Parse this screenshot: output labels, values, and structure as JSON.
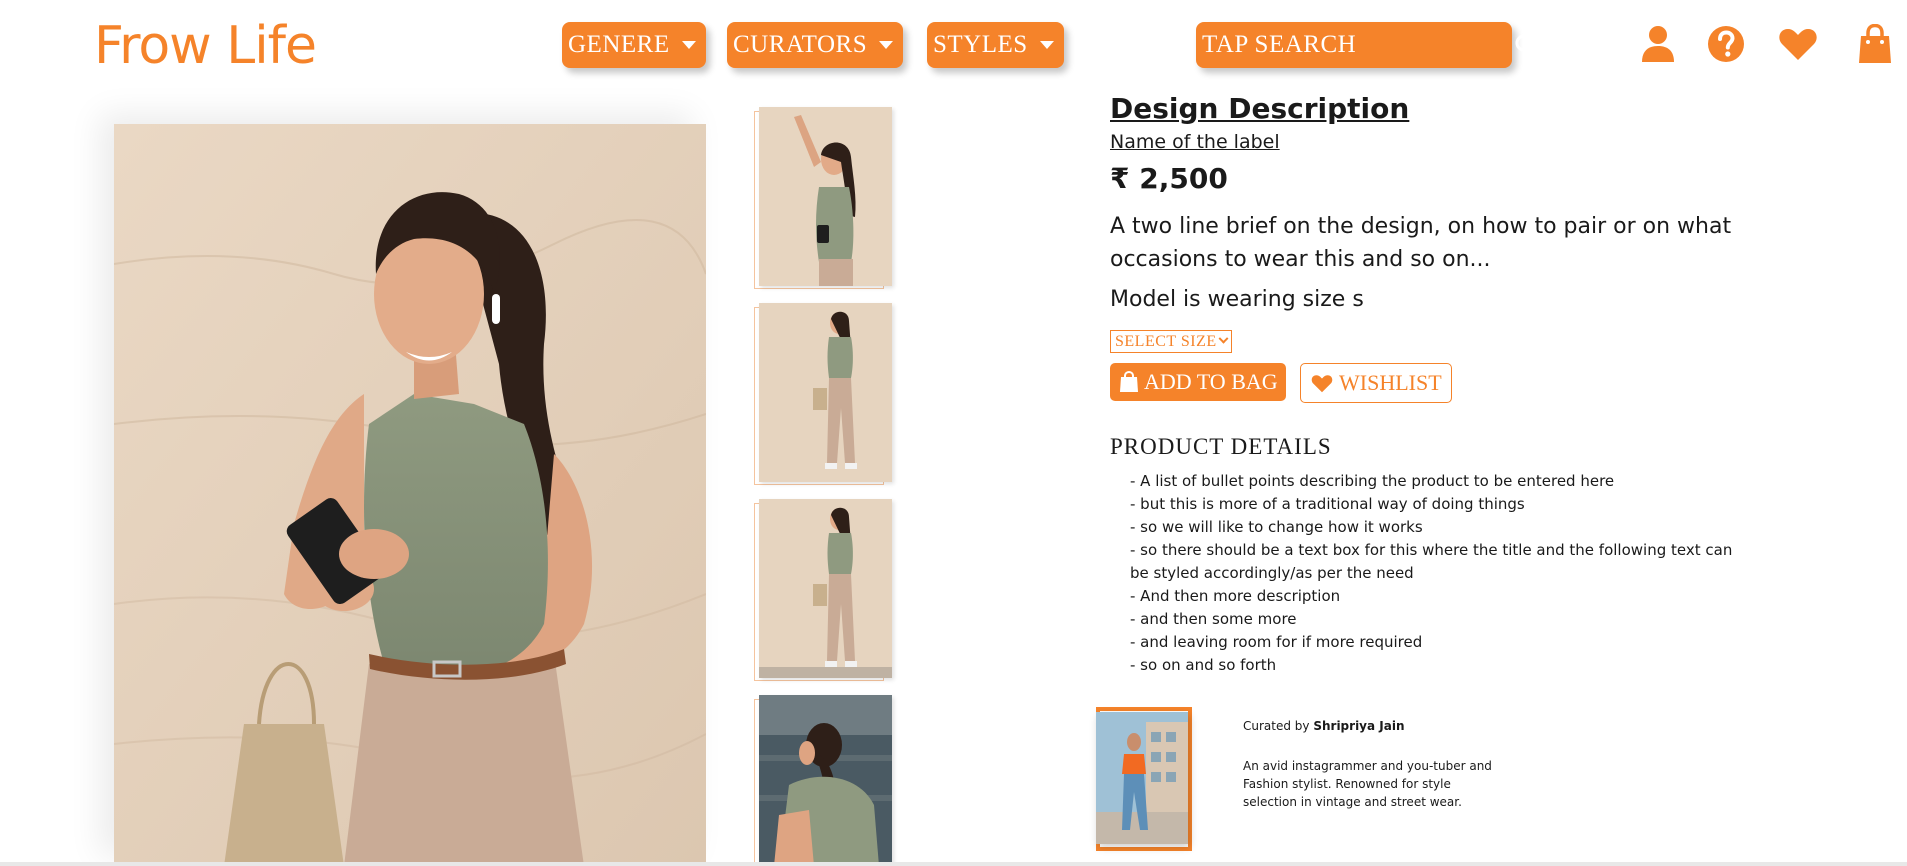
{
  "brand": {
    "logo_text": "Frow Life",
    "accent_color": "#f5832a"
  },
  "nav": {
    "items": [
      {
        "label": "GENERE"
      },
      {
        "label": "CURATORS"
      },
      {
        "label": "STYLES"
      }
    ],
    "search_placeholder": "TAP SEARCH"
  },
  "header_icons": [
    "user-icon",
    "help-icon",
    "heart-icon",
    "shopping-bag-icon"
  ],
  "product": {
    "title": "Design Description",
    "label_name": "Name of the label",
    "price": "₹ 2,500",
    "brief": "A two line brief on the design, on how to pair or on what occasions to wear this and so on...",
    "model_size": "Model is wearing size s",
    "select_size_label": "SELECT SIZE",
    "add_to_bag_label": "ADD TO BAG",
    "wishlist_label": "WISHLIST",
    "details_title": "PRODUCT DETAILS",
    "details": [
      "- A list of bullet points describing the product to be entered here",
      "- but this is more of a traditional way of doing things",
      "- so we will like to change how it works",
      "- so there should be a text box for this where the title and the following text can be styled accordingly/as per the need",
      "- And then more description",
      "- and then some more",
      "- and leaving room for if more required",
      "- so on and so forth"
    ]
  },
  "curator": {
    "prefix": "Curated by",
    "name": "Shripriya Jain",
    "bio": "An avid instagrammer and you-tuber and Fashion stylist. Renowned for style selection in vintage and street wear."
  }
}
